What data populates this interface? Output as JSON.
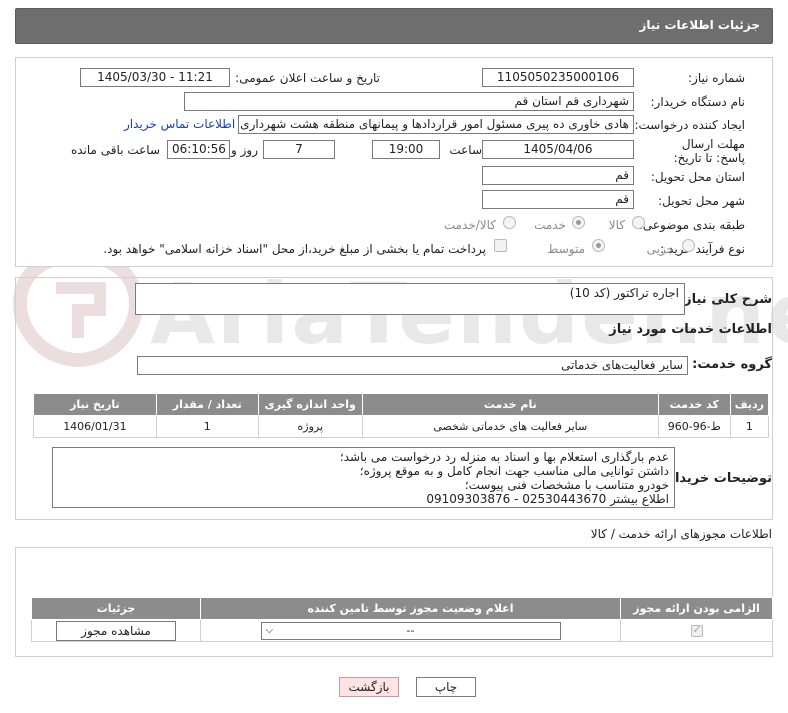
{
  "header": {
    "title": "جزئیات اطلاعات نیاز"
  },
  "form": {
    "need_number_label": "شماره نیاز:",
    "need_number": "1105050235000106",
    "announce_label": "تاریخ و ساعت اعلان عمومی:",
    "announce_value": "1405/03/30 - 11:21",
    "buyer_org_label": "نام دستگاه خریدار:",
    "buyer_org": "شهرداری قم استان قم",
    "requester_label": "ایجاد کننده درخواست:",
    "requester": "هادی خاوری ده پیری مسئول امور قراردادها و پیمانهای منطقه هشت شهرداری",
    "contact_link": "اطلاعات تماس خریدار",
    "deadline_label": "مهلت ارسال پاسخ: تا تاریخ:",
    "deadline_date": "1405/04/06",
    "time_label": "ساعت",
    "deadline_time": "19:00",
    "days_value": "7",
    "days_label": "روز و",
    "remaining_time": "06:10:56",
    "remaining_label": "ساعت باقی مانده",
    "province_label": "استان محل تحویل:",
    "province": "قم",
    "city_label": "شهر محل تحویل:",
    "city": "قم",
    "category_label": "طبقه بندی موضوعی:",
    "category_options": [
      "کالا",
      "خدمت",
      "کالا/خدمت"
    ],
    "process_label": "نوع فرآیند خرید :",
    "process_options": [
      "جزیی",
      "متوسط"
    ],
    "payment_note": "پرداخت تمام یا بخشی از مبلغ خرید،از محل \"اسناد خزانه اسلامی\" خواهد بود."
  },
  "need": {
    "summary_label": "شرح کلی نیاز:",
    "summary": "اجاره تراکتور (کد 10)",
    "services_title": "اطلاعات خدمات مورد نیاز",
    "group_label": "گروه خدمت:",
    "group_value": "سایر فعالیت‌های خدماتی"
  },
  "table": {
    "headers": [
      "ردیف",
      "کد خدمت",
      "نام خدمت",
      "واحد اندازه گیری",
      "تعداد / مقدار",
      "تاریخ نیاز"
    ],
    "rows": [
      [
        "1",
        "ط-96-960",
        "سایر فعالیت های خدماتی شخصی",
        "پروژه",
        "1",
        "1406/01/31"
      ]
    ]
  },
  "notes": {
    "label": "توضیحات خریدار:",
    "lines": [
      "عدم بارگذاری استعلام بها و اسناد به منزله رد درخواست می باشد؛",
      "داشتن توانایی مالی مناسب جهت انجام کامل و به موقع پروژه؛",
      "خودرو متناسب با مشخصات فنی پیوست؛",
      "اطلاع بیشتر 02530443670 - 09109303876"
    ]
  },
  "permits": {
    "title": "اطلاعات مجوزهای ارائه خدمت / کالا",
    "headers": [
      "الزامی بودن ارائه مجوز",
      "اعلام وضعیت مجوز توسط تامین کننده",
      "جزئیات"
    ],
    "select_value": "--",
    "view_button": "مشاهده مجوز"
  },
  "actions": {
    "print": "چاپ",
    "back": "بازگشت"
  },
  "watermark": {
    "text": "AriaTender.neT"
  }
}
